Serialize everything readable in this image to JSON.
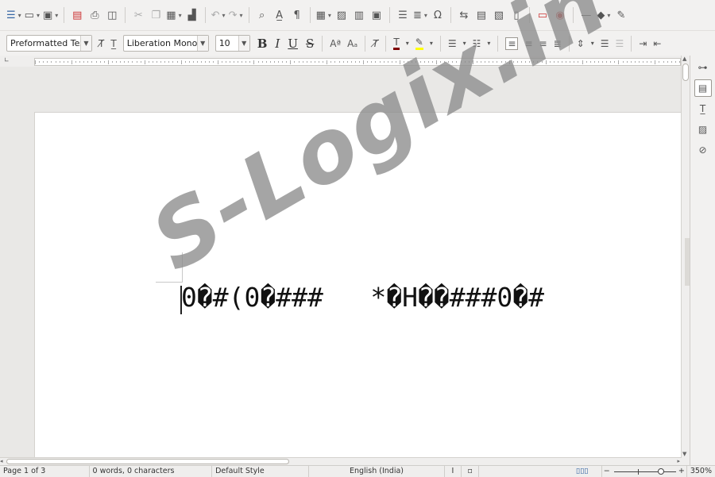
{
  "toolbar1": {
    "icons": [
      "sidebar-toggle-icon",
      "new-document-icon",
      "open-icon",
      "save-icon",
      "export-pdf-icon",
      "print-icon",
      "print-preview-icon",
      "cut-icon",
      "copy-icon",
      "paste-icon",
      "clone-formatting-icon",
      "undo-icon",
      "redo-icon",
      "find-replace-icon",
      "spelling-icon",
      "formatting-marks-icon",
      "insert-table-icon",
      "insert-image-icon",
      "insert-chart-icon",
      "insert-textbox-icon",
      "insert-page-break-icon",
      "insert-field-icon",
      "special-character-icon",
      "hyperlink-icon",
      "footnote-icon",
      "endnote-icon",
      "bookmark-icon",
      "comment-icon",
      "track-changes-icon",
      "line-icon",
      "basic-shapes-icon",
      "draw-icon"
    ]
  },
  "toolbar2": {
    "paragraph_style": "Preformatted Text",
    "font_name": "Liberation Mono",
    "font_size": "10",
    "bold_label": "B",
    "italic_label": "I",
    "underline_label": "U",
    "strike_label": "S"
  },
  "document": {
    "text": "0�#(0�###   *�H��###0�#",
    "watermark": "S-Logix.in"
  },
  "status": {
    "page": "Page 1 of 3",
    "words": "0 words, 0 characters",
    "page_style": "Default Style",
    "language": "English (India)",
    "zoom": "350%",
    "zoom_minus": "−",
    "zoom_plus": "+"
  },
  "colors": {
    "font_color": "#800000",
    "highlight": "#ffff00",
    "watermark": "#8c8c8c"
  }
}
